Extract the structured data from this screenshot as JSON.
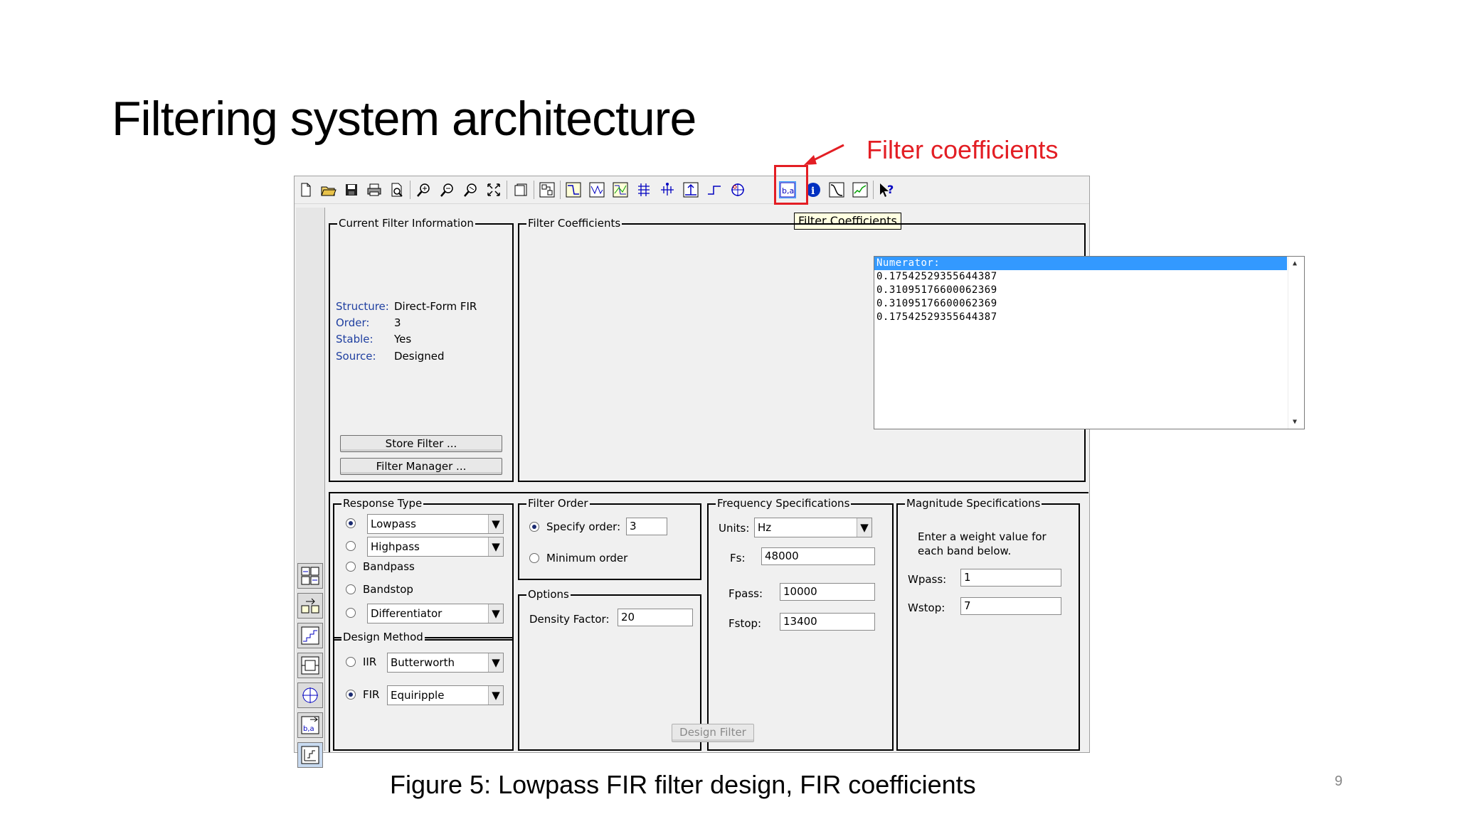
{
  "slide": {
    "title": "Filtering system architecture",
    "annotation": "Filter coefficients",
    "caption": "Figure 5: Lowpass FIR filter design, FIR coefficients",
    "page_number": "9",
    "annotation_color": "#e31e24"
  },
  "toolbar": {
    "tooltip": "Filter Coefficients",
    "icons": [
      "new-file-icon",
      "open-folder-icon",
      "save-icon",
      "print-icon",
      "print-preview-icon",
      "zoom-in-icon",
      "zoom-out-icon",
      "zoom-x-icon",
      "full-view-icon",
      "new-figure-icon",
      "filter-structure-icon",
      "magnitude-response-icon",
      "phase-response-icon",
      "magnitude-phase-icon",
      "group-delay-icon",
      "phase-delay-icon",
      "impulse-response-icon",
      "step-response-icon",
      "pole-zero-icon",
      "filter-coefficients-icon",
      "filter-info-icon",
      "magnitude-estimate-icon",
      "noise-power-icon",
      "whats-this-help-icon"
    ]
  },
  "current_filter": {
    "legend": "Current Filter Information",
    "structure_label": "Structure:",
    "structure_value": "Direct-Form FIR",
    "order_label": "Order:",
    "order_value": "3",
    "stable_label": "Stable:",
    "stable_value": "Yes",
    "source_label": "Source:",
    "source_value": "Designed",
    "store_button": "Store Filter ...",
    "manager_button": "Filter Manager ..."
  },
  "coefficients": {
    "legend": "Filter Coefficients",
    "header": "Numerator:",
    "values": [
      "0.17542529355644387",
      "0.31095176600062369",
      "0.31095176600062369",
      "0.17542529355644387"
    ]
  },
  "response_type": {
    "legend": "Response Type",
    "lowpass": "Lowpass",
    "highpass": "Highpass",
    "bandpass": "Bandpass",
    "bandstop": "Bandstop",
    "differentiator": "Differentiator",
    "selected": "Lowpass"
  },
  "design_method": {
    "legend": "Design Method",
    "iir_label": "IIR",
    "iir_value": "Butterworth",
    "fir_label": "FIR",
    "fir_value": "Equiripple",
    "selected": "FIR"
  },
  "filter_order": {
    "legend": "Filter Order",
    "specify_label": "Specify order:",
    "specify_value": "3",
    "minimum_label": "Minimum order",
    "selected": "Specify order"
  },
  "options": {
    "legend": "Options",
    "density_label": "Density Factor:",
    "density_value": "20"
  },
  "frequency": {
    "legend": "Frequency Specifications",
    "units_label": "Units:",
    "units_value": "Hz",
    "fs_label": "Fs:",
    "fs_value": "48000",
    "fpass_label": "Fpass:",
    "fpass_value": "10000",
    "fstop_label": "Fstop:",
    "fstop_value": "13400"
  },
  "magnitude": {
    "legend": "Magnitude Specifications",
    "instruction_line1": "Enter a weight value for",
    "instruction_line2": "each band below.",
    "wpass_label": "Wpass:",
    "wpass_value": "1",
    "wstop_label": "Wstop:",
    "wstop_value": "7"
  },
  "design_button": "Design Filter"
}
